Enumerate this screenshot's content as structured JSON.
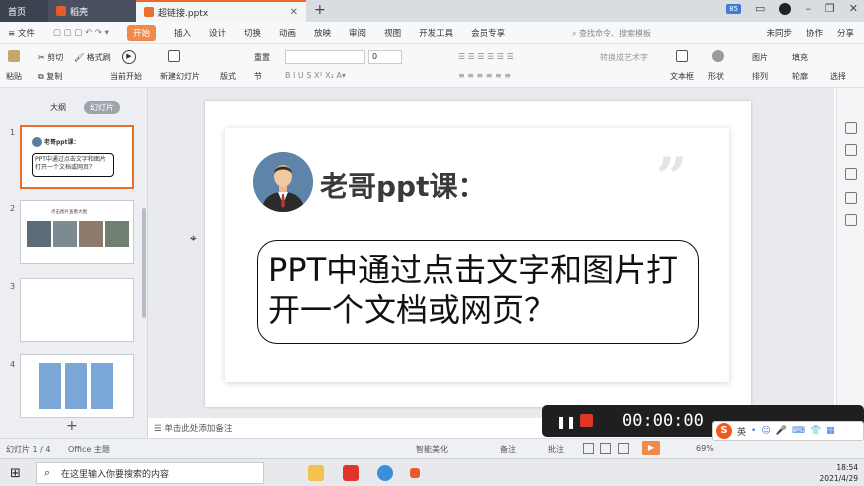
{
  "tabs": {
    "home": "首页",
    "daoke": "稻壳",
    "doc": "超链接.pptx",
    "badge": "85"
  },
  "menu": {
    "file": "≡ 文件",
    "items": [
      "开始",
      "插入",
      "设计",
      "切换",
      "动画",
      "放映",
      "审阅",
      "视图",
      "开发工具",
      "会员专享"
    ],
    "search": "查找命令、搜索模板",
    "cooperate": "未同步",
    "collab": "协作",
    "share": "分享"
  },
  "ribbon": {
    "paste": "粘贴",
    "cut": "剪切",
    "copy": "复制",
    "format_painter": "格式刷",
    "play_from_current": "当前开始",
    "new_slide": "新建幻灯片",
    "layout": "版式",
    "section": "节",
    "reset": "重置",
    "font_size": "0",
    "textbox": "文本框",
    "shape": "形状",
    "arrange": "排列",
    "picture": "图片",
    "fill": "填充",
    "outline": "轮廓",
    "convert_art": "转换成艺术字",
    "text_box_label": "文本框",
    "select": "选择"
  },
  "left_panel": {
    "tab_outline": "大纲",
    "tab_slides": "幻灯片",
    "slide_numbers": [
      "1",
      "2",
      "3",
      "4"
    ],
    "thumb1_title": "老哥ppt课：",
    "thumb1_body": "PPT中通过点击文字和图片打开一个文档或网页？",
    "thumb2_title": "点击图片查看大图"
  },
  "slide": {
    "title": "老哥ppt课：",
    "body": "PPT中通过点击文字和图片打开一个文档或网页？"
  },
  "notes": "单击此处添加备注",
  "status": {
    "slide_info": "幻灯片 1 / 4",
    "theme": "Office 主题",
    "beautify": "智能美化",
    "notes_btn": "备注",
    "comments": "批注",
    "zoom": "69%"
  },
  "recorder": {
    "time": "00:00:00"
  },
  "ime": {
    "logo": "S",
    "lang": "英"
  },
  "taskbar": {
    "search_placeholder": "在这里输入你要搜索的内容",
    "time": "18:54",
    "date": "2021/4/29"
  }
}
